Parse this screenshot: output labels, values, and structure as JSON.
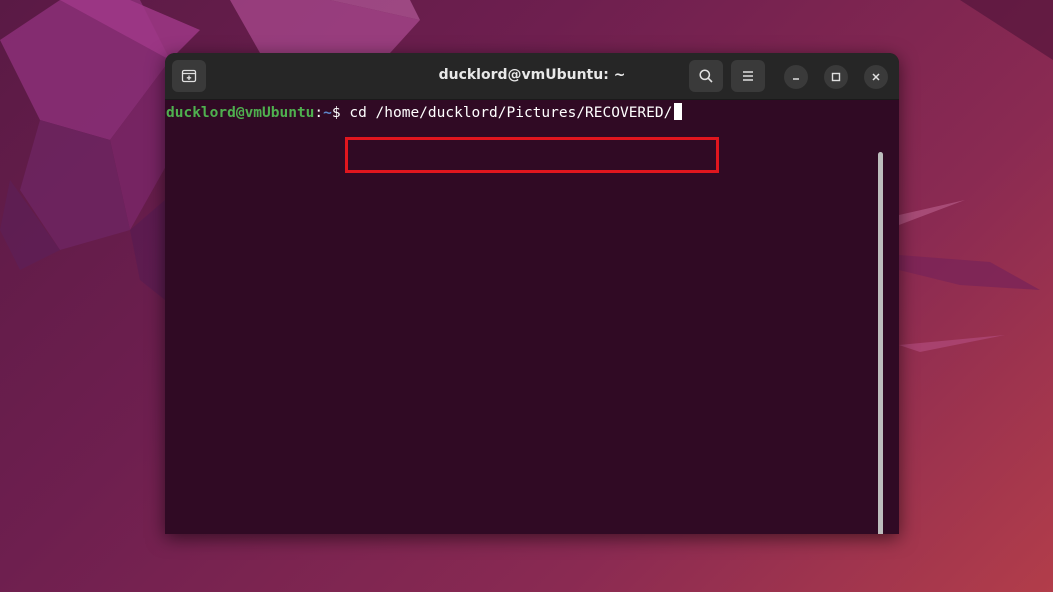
{
  "window": {
    "title": "ducklord@vmUbuntu: ~"
  },
  "prompt": {
    "user_host": "ducklord@vmUbuntu",
    "separator": ":",
    "path": "~",
    "symbol": "$"
  },
  "command": "cd /home/ducklord/Pictures/RECOVERED/",
  "colors": {
    "terminal_bg": "#300a24",
    "prompt_user": "#4fb04f",
    "prompt_path": "#5d86c9",
    "highlight": "#e0161e"
  },
  "icons": {
    "new_tab": "new-tab-icon",
    "search": "search-icon",
    "menu": "hamburger-menu-icon",
    "minimize": "minimize-icon",
    "maximize": "maximize-icon",
    "close": "close-icon"
  }
}
